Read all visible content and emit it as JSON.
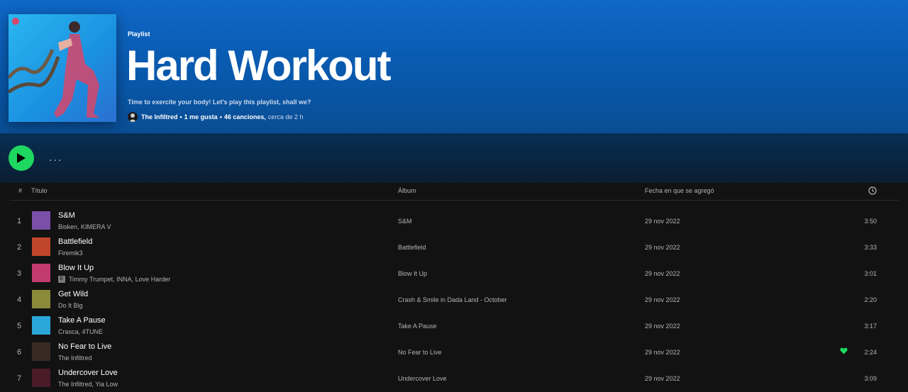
{
  "playlist": {
    "type_label": "Playlist",
    "title": "Hard Workout",
    "description": "Time to exercite your body! Let's play this playlist, shall we?",
    "owner": "The Infiltred",
    "likes": "1 me gusta",
    "song_count": "46 canciones,",
    "duration": "cerca de 2 h",
    "separator": "•"
  },
  "actions": {
    "more_label": "..."
  },
  "columns": {
    "number": "#",
    "title": "Título",
    "album": "Álbum",
    "date_added": "Fecha en que se agregó"
  },
  "tracks": [
    {
      "num": "1",
      "title": "S&M",
      "artists": "Bisken, KIMERA V",
      "explicit": false,
      "album": "S&M",
      "date": "29 nov 2022",
      "duration": "3:50",
      "liked": false,
      "thumb_color": "#7a4fa8"
    },
    {
      "num": "2",
      "title": "Battlefield",
      "artists": "Firemik3",
      "explicit": false,
      "album": "Battlefield",
      "date": "29 nov 2022",
      "duration": "3:33",
      "liked": false,
      "thumb_color": "#c0452b"
    },
    {
      "num": "3",
      "title": "Blow It Up",
      "artists": "Timmy Trumpet, INNA, Love Harder",
      "explicit": true,
      "explicit_label": "E",
      "album": "Blow It Up",
      "date": "29 nov 2022",
      "duration": "3:01",
      "liked": false,
      "thumb_color": "#c23a6e"
    },
    {
      "num": "4",
      "title": "Get Wild",
      "artists": "Do It Big",
      "explicit": false,
      "album": "Crash & Smile in Dada Land - October",
      "date": "29 nov 2022",
      "duration": "2:20",
      "liked": false,
      "thumb_color": "#8a8a3a"
    },
    {
      "num": "5",
      "title": "Take A Pause",
      "artists": "Crasca, 4TUNE",
      "explicit": false,
      "album": "Take A Pause",
      "date": "29 nov 2022",
      "duration": "3:17",
      "liked": false,
      "thumb_color": "#2aa7d8"
    },
    {
      "num": "6",
      "title": "No Fear to Live",
      "artists": "The Infiltred",
      "explicit": false,
      "album": "No Fear to Live",
      "date": "29 nov 2022",
      "duration": "2:24",
      "liked": true,
      "thumb_color": "#3a2a24"
    },
    {
      "num": "7",
      "title": "Undercover Love",
      "artists": "The Infiltred, Yia Low",
      "explicit": false,
      "album": "Undercover Love",
      "date": "29 nov 2022",
      "duration": "3:09",
      "liked": false,
      "thumb_color": "#4a1a28"
    }
  ],
  "colors": {
    "accent": "#1ed760",
    "header_blue": "#0f67c7",
    "background": "#121212"
  },
  "icons": [
    "play-icon",
    "clock-icon",
    "heart-icon",
    "more-icon"
  ]
}
